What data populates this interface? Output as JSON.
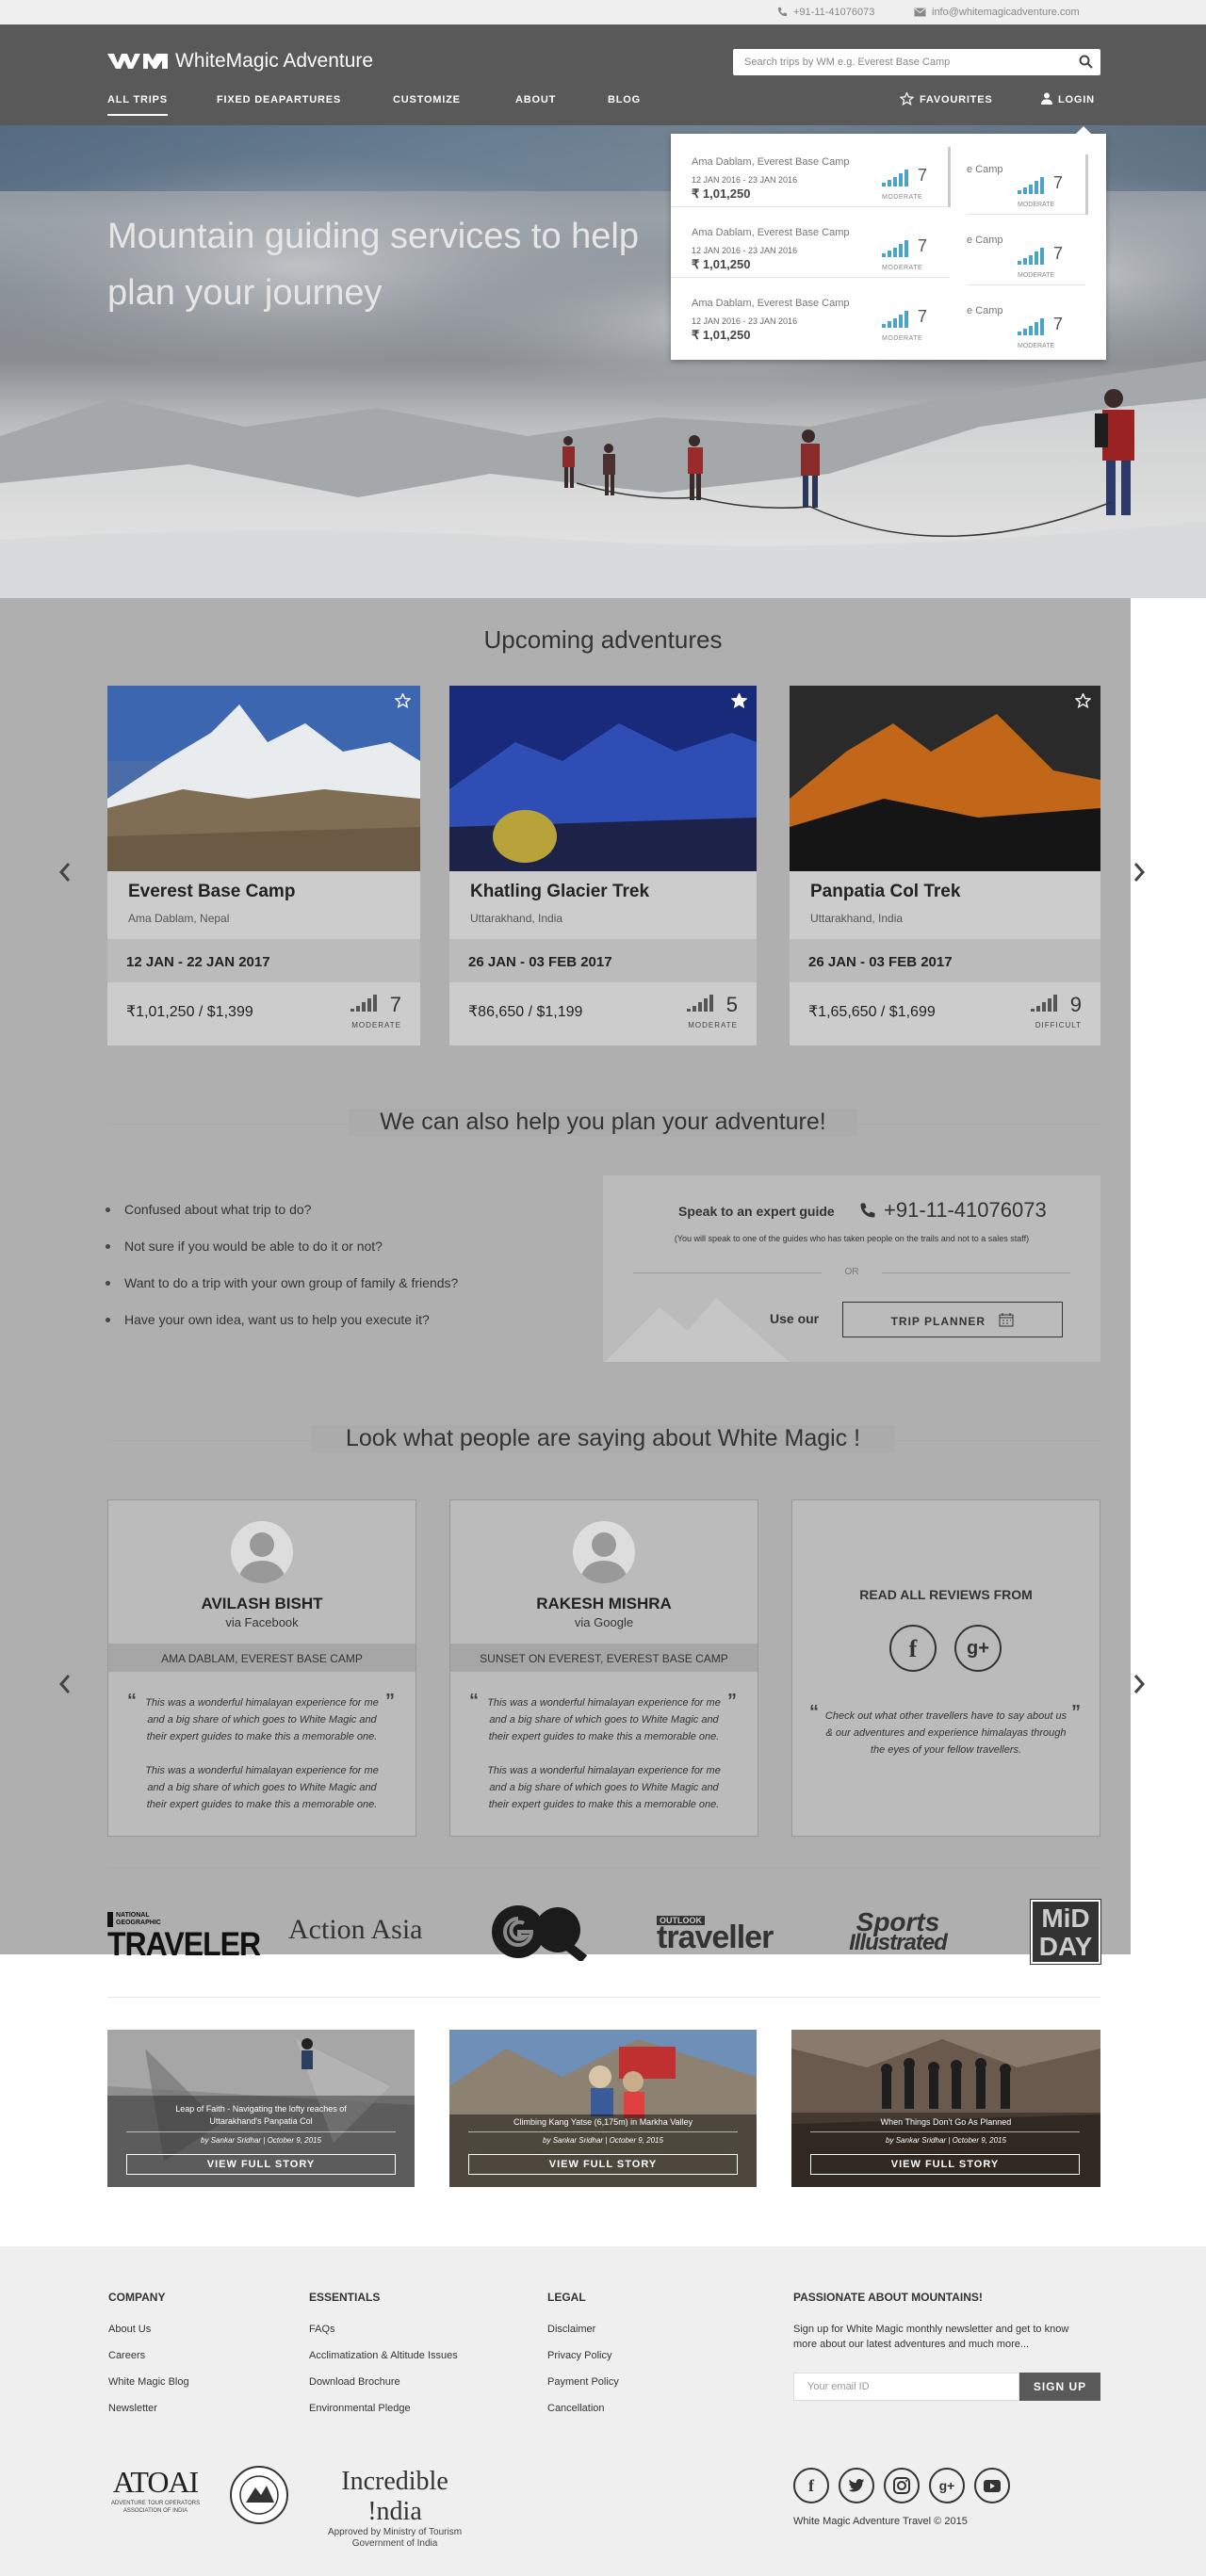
{
  "topbar": {
    "phone": "+91-11-41076073",
    "email": "info@whitemagicadventure.com"
  },
  "header": {
    "logo_text": "WhiteMagic Adventure",
    "search_placeholder": "Search trips by WM e.g. Everest Base Camp",
    "nav": [
      "ALL TRIPS",
      "FIXED DEAPARTURES",
      "CUSTOMIZE",
      "ABOUT",
      "BLOG"
    ],
    "favourites": "FAVOURITES",
    "login": "LOGIN"
  },
  "hero": {
    "headline_1": "Mountain guiding services to help",
    "headline_2": "plan your journey"
  },
  "favourites_dropdown": {
    "items": [
      {
        "title": "Ama Dablam, Everest Base Camp",
        "dates": "12 JAN 2016 - 23 JAN 2016",
        "price": "₹ 1,01,250",
        "grade": "7",
        "level": "MODERATE"
      },
      {
        "title": "Ama Dablam, Everest Base Camp",
        "dates": "12 JAN 2016 - 23 JAN 2016",
        "price": "₹ 1,01,250",
        "grade": "7",
        "level": "MODERATE"
      },
      {
        "title": "Ama Dablam, Everest Base Camp",
        "dates": "12 JAN 2016 - 23 JAN 2016",
        "price": "₹ 1,01,250",
        "grade": "7",
        "level": "MODERATE"
      }
    ],
    "partial_title": "e Camp"
  },
  "upcoming": {
    "title": "Upcoming adventures",
    "cards": [
      {
        "name": "Everest Base Camp",
        "location": "Ama Dablam, Nepal",
        "dates": "12 JAN - 22 JAN 2017",
        "price": "₹1,01,250 / $1,399",
        "grade": "7",
        "level": "MODERATE"
      },
      {
        "name": "Khatling Glacier Trek",
        "location": "Uttarakhand, India",
        "dates": "26 JAN - 03 FEB 2017",
        "price": "₹86,650 / $1,199",
        "grade": "5",
        "level": "MODERATE"
      },
      {
        "name": "Panpatia Col Trek",
        "location": "Uttarakhand, India",
        "dates": "26 JAN - 03 FEB 2017",
        "price": "₹1,65,650 / $1,699",
        "grade": "9",
        "level": "DIFFICULT"
      }
    ]
  },
  "plan": {
    "title": "We can also help you plan your adventure!",
    "bullets": [
      "Confused about what trip to do?",
      "Not sure if you would be able to do it or not?",
      "Want to do a trip with your own group of family & friends?",
      "Have your own idea, want us to help you execute it?"
    ],
    "speak_label": "Speak to an expert guide",
    "phone": "+91-11-41076073",
    "note": "(You will speak to one of the guides who has taken people on the trails and not to a sales staff)",
    "or": "OR",
    "use_our": "Use our",
    "planner_button": "TRIP PLANNER"
  },
  "testimonials": {
    "title": "Look what people are saying about White Magic !",
    "reviews": [
      {
        "name": "AVILASH BISHT",
        "via": "via Facebook",
        "trip": "AMA DABLAM, EVEREST BASE CAMP",
        "quote_1": "This was a wonderful himalayan experience for me and a big share of which goes to White Magic and their expert guides to make this a memorable one.",
        "quote_2": "This was a wonderful himalayan experience for me and a big share of which goes to White Magic and their expert guides to make this a memorable one."
      },
      {
        "name": "RAKESH MISHRA",
        "via": "via Google",
        "trip": "SUNSET ON EVEREST, EVEREST BASE CAMP",
        "quote_1": "This was a wonderful himalayan experience for me and a big share of which goes to White Magic and their expert guides to make this a memorable one.",
        "quote_2": "This was a wonderful himalayan experience for me and a big share of which goes to White Magic and their expert guides to make this a memorable one."
      }
    ],
    "read_all": "READ ALL REVIEWS FROM",
    "read_all_text": "Check out what other travellers have to say about us & our adventures and experience himalayas through the eyes of your fellow travellers."
  },
  "press": {
    "traveler_top": "NATIONAL GEOGRAPHIC",
    "traveler": "TRAVELER",
    "action_asia": "Action Asia",
    "gq": "GQ",
    "outlook_top": "OUTLOOK",
    "outlook": "traveller",
    "si_1": "Sports",
    "si_2": "Illustrated",
    "midday_1": "MiD",
    "midday_2": "DAY"
  },
  "stories": [
    {
      "title_1": "Leap of Faith - Navigating the lofty reaches of",
      "title_2": "Uttarakhand's Panpatia Col",
      "byline": "by Sankar Sridhar | October 9, 2015",
      "button": "VIEW FULL STORY"
    },
    {
      "title_1": "Climbing Kang Yatse (6,175m) in Markha Valley",
      "title_2": "",
      "byline": "by Sankar Sridhar | October 9, 2015",
      "button": "VIEW FULL STORY"
    },
    {
      "title_1": "When Things Don't Go As Planned",
      "title_2": "",
      "byline": "by Sankar Sridhar | October 9, 2015",
      "button": "VIEW FULL STORY"
    }
  ],
  "footer": {
    "company": {
      "title": "COMPANY",
      "links": [
        "About Us",
        "Careers",
        "White Magic Blog",
        "Newsletter"
      ]
    },
    "essentials": {
      "title": "ESSENTIALS",
      "links": [
        "FAQs",
        "Acclimatization & Altitude Issues",
        "Download Brochure",
        "Environmental Pledge"
      ]
    },
    "legal": {
      "title": "LEGAL",
      "links": [
        "Disclaimer",
        "Privacy Policy",
        "Payment Policy",
        "Cancellation"
      ]
    },
    "newsletter": {
      "title": "PASSIONATE ABOUT MOUNTAINS!",
      "text": "Sign up for White Magic monthly newsletter and get to know more about our latest adventures and much more...",
      "placeholder": "Your email ID",
      "button": "SIGN UP"
    },
    "atoai": "ATOAI",
    "atoai_sub_1": "ADVENTURE TOUR OPERATORS",
    "atoai_sub_2": "ASSOCIATION OF INDIA",
    "incredible": "Incredible !ndia",
    "incredible_sub_1": "Approved by Ministry of Tourism",
    "incredible_sub_2": "Government of India",
    "copyright": "White Magic Adventure Travel © 2015"
  }
}
